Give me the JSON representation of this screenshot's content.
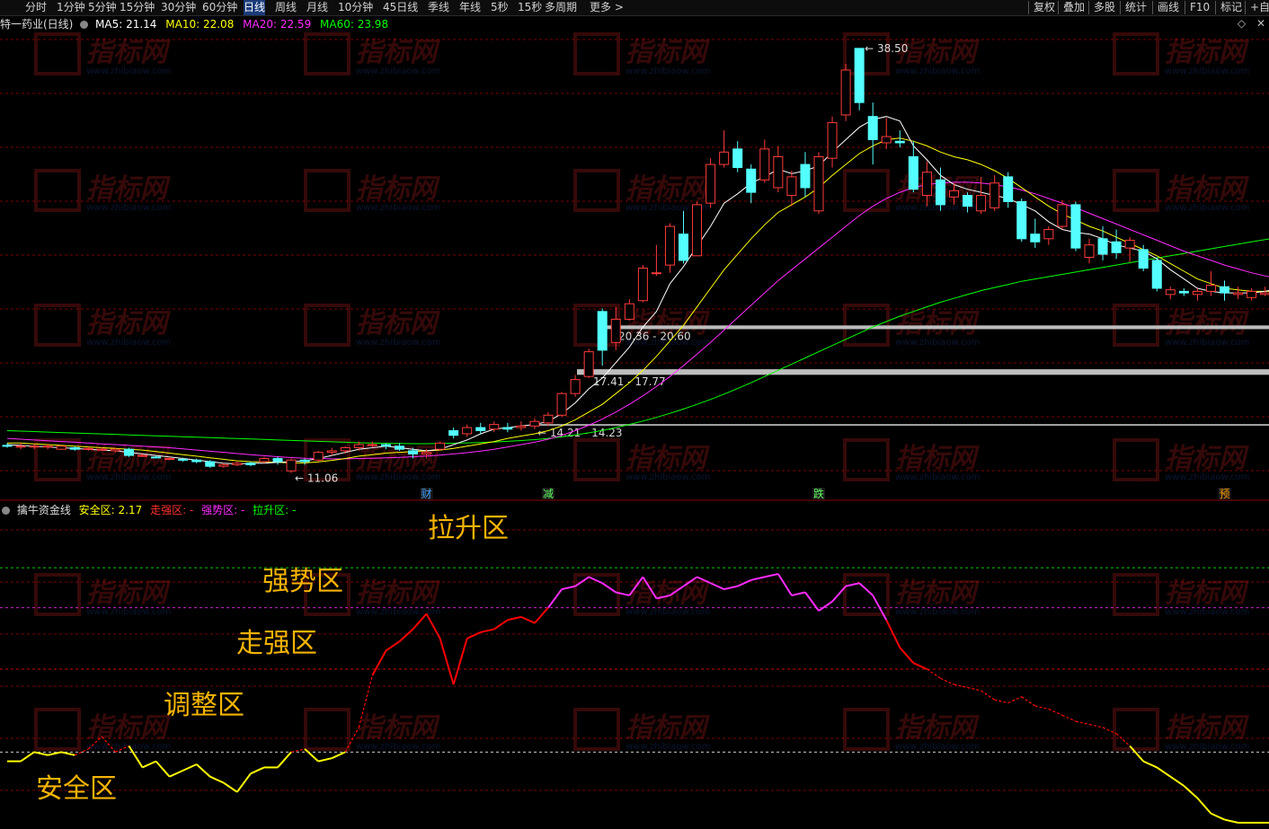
{
  "toolbar": {
    "left": [
      "分时",
      "1分钟",
      "5分钟",
      "15分钟",
      "30分钟",
      "60分钟",
      "日线",
      "周线",
      "月线",
      "10分钟",
      "45日线",
      "季线",
      "年线",
      "5秒",
      "15秒",
      "多周期",
      "更多 >"
    ],
    "active": "日线",
    "right": [
      "复权",
      "叠加",
      "多股",
      "统计",
      "画线",
      "F10",
      "标记",
      "+自"
    ]
  },
  "main_header": {
    "title": "特一药业(日线)",
    "ma5": "MA5: 21.14",
    "ma10": "MA10: 22.08",
    "ma20": "MA20: 22.59",
    "ma60": "MA60: 23.98"
  },
  "indicator_header": {
    "name": "擒牛资金线",
    "safe": "安全区: 2.17",
    "strong": "走强区: -",
    "power": "强势区: -",
    "lift": "拉升区: -"
  },
  "watermark": {
    "big": "指标网",
    "small": "www.zhibiaow.com"
  },
  "colors": {
    "up": "#ff3b3b",
    "down": "#54ffff",
    "ma5": "#ffffff",
    "ma10": "#ffff00",
    "ma20": "#ff2cff",
    "ma60": "#00ff00",
    "grid": "#7a0000",
    "safe": "#ffff00",
    "strong": "#ff0000",
    "power": "#ff2cff",
    "lift": "#00ff00",
    "zone_label": "#f5b400"
  },
  "chart_data": [
    {
      "type": "candlestick",
      "title": "特一药业(日线)",
      "ylim": [
        10,
        40
      ],
      "high_mark": "38.50",
      "low_mark": "11.06",
      "levels": [
        {
          "low": 20.36,
          "high": 20.6,
          "text": "20.36 - 20.60"
        },
        {
          "low": 17.41,
          "high": 17.77,
          "text": "17.41 - 17.77"
        },
        {
          "low": 14.21,
          "high": 14.23,
          "text": "14.21 - 14.23"
        }
      ],
      "events": [
        {
          "day": 31,
          "text": "财",
          "color": "#3fa0ff"
        },
        {
          "day": 40,
          "text": "减",
          "color": "#5fff5f"
        },
        {
          "day": 60,
          "text": "跌",
          "color": "#5fff5f"
        },
        {
          "day": 90,
          "text": "预",
          "color": "#ff9a00"
        }
      ],
      "candles": [
        [
          12.85,
          12.8,
          13.0,
          12.7
        ],
        [
          12.8,
          12.8,
          13.0,
          12.6
        ],
        [
          12.8,
          12.8,
          12.95,
          12.6
        ],
        [
          12.8,
          12.8,
          12.95,
          12.6
        ],
        [
          12.6,
          12.8,
          12.85,
          12.55
        ],
        [
          12.7,
          12.6,
          12.8,
          12.5
        ],
        [
          12.6,
          12.65,
          12.8,
          12.5
        ],
        [
          12.6,
          12.6,
          12.75,
          12.5
        ],
        [
          12.5,
          12.6,
          12.7,
          12.4
        ],
        [
          12.6,
          12.2,
          12.7,
          12.1
        ],
        [
          12.15,
          12.2,
          12.3,
          12.1
        ],
        [
          12.1,
          12.05,
          12.2,
          12.0
        ],
        [
          12.0,
          12.0,
          12.1,
          11.9
        ],
        [
          11.95,
          11.9,
          12.05,
          11.8
        ],
        [
          11.9,
          11.8,
          12.0,
          11.7
        ],
        [
          11.8,
          11.5,
          11.9,
          11.4
        ],
        [
          11.5,
          11.6,
          11.7,
          11.4
        ],
        [
          11.6,
          11.7,
          11.8,
          11.5
        ],
        [
          11.7,
          11.6,
          11.8,
          11.5
        ],
        [
          11.8,
          12.0,
          12.1,
          11.7
        ],
        [
          12.0,
          11.8,
          12.1,
          11.6
        ],
        [
          11.2,
          11.9,
          12.0,
          11.06
        ],
        [
          11.9,
          11.8,
          12.0,
          11.6
        ],
        [
          11.9,
          12.4,
          12.5,
          11.8
        ],
        [
          12.4,
          12.5,
          12.7,
          12.2
        ],
        [
          12.5,
          12.7,
          12.8,
          12.3
        ],
        [
          12.7,
          12.9,
          13.1,
          12.5
        ],
        [
          12.9,
          12.9,
          13.1,
          12.7
        ],
        [
          12.9,
          12.8,
          13.0,
          12.6
        ],
        [
          12.8,
          12.6,
          13.0,
          12.5
        ],
        [
          12.5,
          12.3,
          12.7,
          12.0
        ],
        [
          12.3,
          12.4,
          12.6,
          12.0
        ],
        [
          12.6,
          13.0,
          13.1,
          12.5
        ],
        [
          13.8,
          13.5,
          14.0,
          13.3
        ],
        [
          13.6,
          14.0,
          14.2,
          13.4
        ],
        [
          14.0,
          13.8,
          14.3,
          13.6
        ],
        [
          13.9,
          14.2,
          14.4,
          13.7
        ],
        [
          14.0,
          13.9,
          14.3,
          13.7
        ],
        [
          14.0,
          14.1,
          14.4,
          13.8
        ],
        [
          14.1,
          14.4,
          14.6,
          13.9
        ],
        [
          14.3,
          14.8,
          15.0,
          14.1
        ],
        [
          14.8,
          16.2,
          16.3,
          14.7
        ],
        [
          16.2,
          17.1,
          17.4,
          16.0
        ],
        [
          17.3,
          18.9,
          19.1,
          17.2
        ],
        [
          21.5,
          19.0,
          21.7,
          18.0
        ],
        [
          19.5,
          21.0,
          21.8,
          19.0
        ],
        [
          21.0,
          22.0,
          22.3,
          20.9
        ],
        [
          22.2,
          24.3,
          24.5,
          22.1
        ],
        [
          24.0,
          24.0,
          25.8,
          23.8
        ],
        [
          24.5,
          27.0,
          27.2,
          24.0
        ],
        [
          26.5,
          24.8,
          28.0,
          24.6
        ],
        [
          25.1,
          28.4,
          28.6,
          25.1
        ],
        [
          28.5,
          31.0,
          31.4,
          28.2
        ],
        [
          31.0,
          31.8,
          33.2,
          30.8
        ],
        [
          32.0,
          30.8,
          32.5,
          30.5
        ],
        [
          30.7,
          29.2,
          31.0,
          28.5
        ],
        [
          30.0,
          32.0,
          32.6,
          29.8
        ],
        [
          29.5,
          31.5,
          32.2,
          29.2
        ],
        [
          29.0,
          30.2,
          30.6,
          28.3
        ],
        [
          31.0,
          29.5,
          31.8,
          28.9
        ],
        [
          28.0,
          31.5,
          31.8,
          27.8
        ],
        [
          31.4,
          33.7,
          34.1,
          30.8
        ],
        [
          34.2,
          37.1,
          37.5,
          33.8
        ],
        [
          38.5,
          35.0,
          38.5,
          34.5
        ],
        [
          34.1,
          32.6,
          35.0,
          31.0
        ],
        [
          32.4,
          32.8,
          34.0,
          32.0
        ],
        [
          32.5,
          32.4,
          33.2,
          32.1
        ],
        [
          31.5,
          29.4,
          32.5,
          29.2
        ],
        [
          29.0,
          30.5,
          31.2,
          28.3
        ],
        [
          30.0,
          28.4,
          30.8,
          28.0
        ],
        [
          28.9,
          29.3,
          29.8,
          28.4
        ],
        [
          29.0,
          28.3,
          29.2,
          27.9
        ],
        [
          28.0,
          29.0,
          30.2,
          27.8
        ],
        [
          28.2,
          29.8,
          30.3,
          28.0
        ],
        [
          30.2,
          28.6,
          30.5,
          28.2
        ],
        [
          28.6,
          26.2,
          28.8,
          26.0
        ],
        [
          26.5,
          26.0,
          27.5,
          25.6
        ],
        [
          26.2,
          26.8,
          27.0,
          25.8
        ],
        [
          27.0,
          28.4,
          28.7,
          26.8
        ],
        [
          28.4,
          25.6,
          28.6,
          25.4
        ],
        [
          25.0,
          25.8,
          26.2,
          24.6
        ],
        [
          26.2,
          25.2,
          27.0,
          24.8
        ],
        [
          26.0,
          25.3,
          26.8,
          24.9
        ],
        [
          25.6,
          26.1,
          26.3,
          24.7
        ],
        [
          25.5,
          24.3,
          25.8,
          24.1
        ],
        [
          24.8,
          23.0,
          25.0,
          22.8
        ],
        [
          22.6,
          22.9,
          23.1,
          22.3
        ],
        [
          22.8,
          22.7,
          23.0,
          22.5
        ],
        [
          22.6,
          22.8,
          23.0,
          22.2
        ],
        [
          22.8,
          23.2,
          24.1,
          22.5
        ],
        [
          23.1,
          22.7,
          23.5,
          22.2
        ],
        [
          22.6,
          22.7,
          23.1,
          22.3
        ],
        [
          22.4,
          22.8,
          23.0,
          22.2
        ],
        [
          22.6,
          22.7,
          23.1,
          22.5
        ],
        [
          23.0,
          23.3,
          23.5,
          22.8
        ],
        [
          23.6,
          23.8,
          24.8,
          23.2
        ],
        [
          24.2,
          23.0,
          24.3,
          22.8
        ],
        [
          22.9,
          22.1,
          23.0,
          21.9
        ],
        [
          22.4,
          21.6,
          22.5,
          21.3
        ],
        [
          21.7,
          21.2,
          21.9,
          21.0
        ],
        [
          21.0,
          20.4,
          21.2,
          20.2
        ],
        [
          20.6,
          20.3,
          20.7,
          20.1
        ],
        [
          20.1,
          20.3,
          20.5,
          19.9
        ],
        [
          20.4,
          20.9,
          21.0,
          20.3
        ]
      ],
      "ma5": [
        12.9,
        12.85,
        12.8,
        12.75,
        12.7,
        12.65,
        12.6,
        12.55,
        12.5,
        12.4,
        12.3,
        12.2,
        12.1,
        12.0,
        11.9,
        11.8,
        11.7,
        11.65,
        11.7,
        11.7,
        11.75,
        11.8,
        11.85,
        12.0,
        12.2,
        12.4,
        12.6,
        12.7,
        12.8,
        12.7,
        12.6,
        12.5,
        12.6,
        12.9,
        13.2,
        13.6,
        13.9,
        14.0,
        14.1,
        14.2,
        14.4,
        14.9,
        15.6,
        16.5,
        17.2,
        18.2,
        19.2,
        20.5,
        21.5,
        23.3,
        24.4,
        25.7,
        27.0,
        28.5,
        29.1,
        29.8,
        30.2,
        30.7,
        30.4,
        30.6,
        30.9,
        31.8,
        32.6,
        33.4,
        33.9,
        34.1,
        33.8,
        32.2,
        31.3,
        30.3,
        29.7,
        29.4,
        29.2,
        29.0,
        28.8,
        28.4,
        28.0,
        27.3,
        26.8,
        26.6,
        26.5,
        26.2,
        25.8,
        25.6,
        25.4,
        24.9,
        24.2,
        23.6,
        23.0,
        22.8,
        22.7,
        22.7,
        22.7,
        22.8,
        23.0,
        23.1,
        23.0,
        22.7,
        22.4,
        21.9,
        21.3,
        20.9,
        20.6,
        20.5
      ],
      "ma10": [
        13.0,
        13.0,
        12.95,
        12.9,
        12.85,
        12.8,
        12.75,
        12.7,
        12.65,
        12.6,
        12.55,
        12.45,
        12.35,
        12.25,
        12.15,
        12.05,
        11.95,
        11.85,
        11.8,
        11.78,
        11.75,
        11.72,
        11.72,
        11.78,
        11.88,
        12.0,
        12.15,
        12.25,
        12.35,
        12.4,
        12.45,
        12.5,
        12.55,
        12.65,
        12.8,
        12.95,
        13.1,
        13.3,
        13.45,
        13.6,
        13.8,
        14.1,
        14.5,
        15.0,
        15.5,
        16.2,
        16.9,
        17.7,
        18.6,
        19.6,
        20.6,
        21.8,
        23.0,
        24.2,
        25.2,
        26.2,
        27.1,
        27.9,
        28.4,
        28.9,
        29.5,
        30.3,
        31.0,
        31.7,
        32.2,
        32.6,
        32.7,
        32.5,
        32.2,
        31.8,
        31.5,
        31.3,
        31.0,
        30.6,
        30.1,
        29.5,
        28.9,
        28.3,
        27.8,
        27.4,
        27.0,
        26.7,
        26.3,
        25.9,
        25.5,
        25.1,
        24.6,
        24.1,
        23.6,
        23.3,
        23.0,
        22.9,
        22.8,
        22.8,
        22.8,
        22.8,
        22.8,
        22.7,
        22.5,
        22.3,
        22.0,
        21.7,
        21.4,
        21.1
      ],
      "ma20": [
        13.3,
        13.25,
        13.2,
        13.15,
        13.1,
        13.05,
        13.0,
        12.95,
        12.9,
        12.85,
        12.8,
        12.75,
        12.7,
        12.62,
        12.55,
        12.47,
        12.4,
        12.32,
        12.25,
        12.18,
        12.12,
        12.06,
        12.02,
        12.0,
        11.98,
        11.98,
        12.0,
        12.02,
        12.05,
        12.08,
        12.12,
        12.16,
        12.22,
        12.3,
        12.38,
        12.48,
        12.6,
        12.75,
        12.9,
        13.05,
        13.25,
        13.5,
        13.8,
        14.15,
        14.55,
        15.0,
        15.5,
        16.05,
        16.65,
        17.3,
        18.0,
        18.75,
        19.5,
        20.3,
        21.1,
        21.9,
        22.7,
        23.5,
        24.2,
        24.9,
        25.6,
        26.3,
        27.0,
        27.7,
        28.3,
        28.8,
        29.2,
        29.5,
        29.7,
        29.8,
        29.85,
        29.85,
        29.8,
        29.7,
        29.55,
        29.35,
        29.1,
        28.8,
        28.5,
        28.2,
        27.85,
        27.5,
        27.15,
        26.8,
        26.45,
        26.1,
        25.75,
        25.4,
        25.1,
        24.8,
        24.5,
        24.25,
        24.0,
        23.8,
        23.6,
        23.4,
        23.2,
        23.0,
        22.8,
        22.6,
        22.4,
        22.2,
        22.0,
        21.8
      ],
      "ma60": [
        13.8,
        13.77,
        13.74,
        13.71,
        13.68,
        13.65,
        13.62,
        13.59,
        13.56,
        13.53,
        13.5,
        13.47,
        13.44,
        13.41,
        13.38,
        13.35,
        13.32,
        13.29,
        13.26,
        13.23,
        13.2,
        13.17,
        13.14,
        13.11,
        13.08,
        13.05,
        13.02,
        13.0,
        12.98,
        12.97,
        12.96,
        12.96,
        12.97,
        12.99,
        13.01,
        13.04,
        13.07,
        13.11,
        13.16,
        13.22,
        13.3,
        13.4,
        13.52,
        13.66,
        13.82,
        14.0,
        14.2,
        14.42,
        14.66,
        14.92,
        15.2,
        15.5,
        15.82,
        16.16,
        16.52,
        16.9,
        17.3,
        17.7,
        18.1,
        18.5,
        18.9,
        19.3,
        19.7,
        20.1,
        20.5,
        20.85,
        21.2,
        21.5,
        21.8,
        22.1,
        22.35,
        22.6,
        22.85,
        23.05,
        23.25,
        23.45,
        23.6,
        23.75,
        23.9,
        24.05,
        24.2,
        24.35,
        24.5,
        24.65,
        24.8,
        24.95,
        25.1,
        25.25,
        25.4,
        25.55,
        25.7,
        25.85,
        26.0,
        26.15,
        26.3,
        26.45,
        26.6,
        26.75,
        26.9,
        27.05,
        27.2,
        27.35,
        27.5,
        27.65
      ]
    },
    {
      "type": "line",
      "name": "擒牛资金线",
      "ylim": [
        0,
        100
      ],
      "thresholds": [
        {
          "label": "拉升区",
          "level": 83,
          "color": "#00ff00"
        },
        {
          "label": "强势区",
          "level": 70,
          "color": "#ff2cff"
        },
        {
          "label": "走强区",
          "level": 50,
          "color": "#ff0000"
        },
        {
          "label": "调整区",
          "level": 23,
          "color": "#ffffff"
        }
      ],
      "values": [
        20,
        20,
        23,
        22,
        23,
        22,
        24,
        28,
        23,
        25,
        18,
        20,
        15,
        17,
        19,
        15,
        13,
        10,
        16,
        18,
        18,
        23,
        24,
        20,
        21,
        23,
        31,
        48,
        56,
        59,
        63,
        68,
        60,
        45,
        60,
        62,
        63,
        66,
        67,
        65,
        70,
        76,
        77,
        80,
        78,
        75,
        74,
        80,
        73,
        74,
        77,
        80,
        78,
        76,
        77,
        79,
        80,
        81,
        74,
        75,
        69,
        72,
        77,
        78,
        74,
        66,
        57,
        52,
        50,
        47,
        45,
        44,
        43,
        40,
        39,
        41,
        38,
        37,
        35,
        33,
        32,
        31,
        29,
        25,
        20,
        18,
        15,
        12,
        8,
        3,
        1,
        0,
        0,
        0,
        0,
        0,
        0,
        0,
        0,
        0,
        -1,
        -1,
        0,
        1
      ],
      "annotations": [
        "安全区",
        "调整区",
        "走强区",
        "强势区",
        "拉升区"
      ]
    }
  ]
}
